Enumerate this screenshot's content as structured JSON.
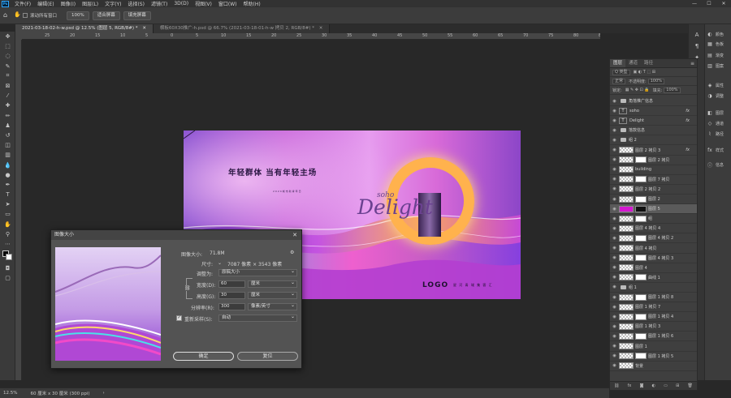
{
  "menubar": {
    "logo": "Ps",
    "items": [
      "文件(F)",
      "编辑(E)",
      "图像(I)",
      "图层(L)",
      "文字(Y)",
      "选择(S)",
      "滤镜(T)",
      "3D(D)",
      "视图(V)",
      "窗口(W)",
      "帮助(H)"
    ],
    "minimize": "—",
    "maximize": "☐",
    "close": "✕"
  },
  "options": {
    "scroll_all_label": "滚动所有窗口",
    "zoom_value": "100%",
    "fit_screen_label": "适合屏幕",
    "fill_screen_label": "填充屏幕"
  },
  "tabs": [
    {
      "label": "2021-03-18-02-h-w.psd @ 12.5% (图层 5, RGB/8#) *",
      "close": "✕"
    },
    {
      "label": "横板60X30推广-h.psd @ 66.7% (2021-03-18-01-h-w 拷贝 2, RGB/8#) *",
      "close": "✕"
    }
  ],
  "ruler_numbers": [
    "25",
    "20",
    "15",
    "10",
    "5",
    "0",
    "5",
    "10",
    "15",
    "20",
    "25",
    "30",
    "35",
    "40",
    "45",
    "50",
    "55",
    "60",
    "65",
    "70",
    "75",
    "80",
    "85"
  ],
  "artwork": {
    "headline": "年轻群体  当有年轻主场",
    "tagline": "2024城市新青年日",
    "script_small": "soho",
    "script_large": "Delight",
    "logo": "LOGO",
    "small_line": "星 河 青 域 集 客 汇"
  },
  "dialog": {
    "title": "图像大小",
    "image_size_label": "图像大小:",
    "image_size_value": "71.8M",
    "dimensions_label": "尺寸:",
    "dimensions_value": "7087 像素 × 3543 像素",
    "fit_label": "调整为:",
    "fit_value": "原稿大小",
    "width_label": "宽度(D):",
    "width_value": "60",
    "width_unit": "厘米",
    "height_label": "高度(G):",
    "height_value": "30",
    "height_unit": "厘米",
    "resolution_label": "分辨率(R):",
    "resolution_value": "300",
    "resolution_unit": "像素/英寸",
    "resample_label": "重新采样(S):",
    "resample_checked": true,
    "resample_value": "自动",
    "ok_label": "确定",
    "reset_label": "复位"
  },
  "right_panels": [
    {
      "icon": "◐",
      "label": "颜色"
    },
    {
      "icon": "▦",
      "label": "色板"
    },
    {
      "icon": "▤",
      "label": "渐变"
    },
    {
      "icon": "▥",
      "label": "图案"
    },
    {
      "icon": "◈",
      "label": "属性"
    },
    {
      "icon": "◑",
      "label": "调整"
    },
    {
      "icon": "◧",
      "label": "图层"
    },
    {
      "icon": "◇",
      "label": "通道"
    },
    {
      "icon": "⌇",
      "label": "路径"
    },
    {
      "icon": "fx",
      "label": "样式"
    },
    {
      "icon": "ⓘ",
      "label": "信息"
    }
  ],
  "layers_panel": {
    "tabs": [
      "图层",
      "通道",
      "路径"
    ],
    "search_label": "Q 类型",
    "blend_mode": "正常",
    "opacity_label": "不透明度:",
    "opacity_value": "100%",
    "lock_label": "锁定:",
    "fill_label": "填充:",
    "fill_value": "100%",
    "layers": [
      {
        "name": "角落推广信息",
        "kind": "folder",
        "fx": false,
        "selected": false
      },
      {
        "name": "soho",
        "kind": "text",
        "fx": true,
        "selected": false
      },
      {
        "name": "Delight",
        "kind": "text",
        "fx": true,
        "selected": false
      },
      {
        "name": "落款信息",
        "kind": "folder",
        "fx": false,
        "selected": false
      },
      {
        "name": "组 2",
        "kind": "folder",
        "fx": false,
        "selected": false
      },
      {
        "name": "图层 2 拷贝 3",
        "kind": "layer",
        "fx": true,
        "selected": false
      },
      {
        "name": "图层 2 拷贝",
        "kind": "layer",
        "fx": false,
        "selected": false
      },
      {
        "name": "building",
        "kind": "layer",
        "fx": false,
        "selected": false
      },
      {
        "name": "图层 7 拷贝",
        "kind": "layer",
        "fx": false,
        "selected": false
      },
      {
        "name": "图层 2 拷贝 2",
        "kind": "layer",
        "fx": false,
        "selected": false
      },
      {
        "name": "图层 2",
        "kind": "layer",
        "fx": false,
        "selected": false
      },
      {
        "name": "图层 5",
        "kind": "layer",
        "fx": false,
        "selected": true
      },
      {
        "name": "组",
        "kind": "layer",
        "fx": false,
        "selected": false
      },
      {
        "name": "图层 4 拷贝 4",
        "kind": "layer",
        "fx": false,
        "selected": false
      },
      {
        "name": "图层 4 拷贝 2",
        "kind": "layer",
        "fx": false,
        "selected": false
      },
      {
        "name": "图层 4 拷贝",
        "kind": "layer",
        "fx": false,
        "selected": false
      },
      {
        "name": "图层 4 拷贝 3",
        "kind": "layer",
        "fx": false,
        "selected": false
      },
      {
        "name": "图层 4",
        "kind": "layer",
        "fx": false,
        "selected": false
      },
      {
        "name": "曲线 1",
        "kind": "layer",
        "fx": false,
        "selected": false
      },
      {
        "name": "组 1",
        "kind": "folder",
        "fx": false,
        "selected": false
      },
      {
        "name": "图层 1 拷贝 8",
        "kind": "layer",
        "fx": false,
        "selected": false
      },
      {
        "name": "图层 1 拷贝 7",
        "kind": "layer",
        "fx": false,
        "selected": false
      },
      {
        "name": "图层 1 拷贝 4",
        "kind": "layer",
        "fx": false,
        "selected": false
      },
      {
        "name": "图层 1 拷贝 3",
        "kind": "layer",
        "fx": false,
        "selected": false
      },
      {
        "name": "图层 1 拷贝 6",
        "kind": "layer",
        "fx": false,
        "selected": false
      },
      {
        "name": "图层 1",
        "kind": "layer",
        "fx": false,
        "selected": false
      },
      {
        "name": "图层 1 拷贝 5",
        "kind": "layer",
        "fx": false,
        "selected": false
      },
      {
        "name": "背景",
        "kind": "layer",
        "fx": false,
        "selected": false
      }
    ]
  },
  "status": {
    "zoom": "12.5%",
    "doc_info": "60 厘米 x 30 厘米 (300 ppi)",
    "arrow": "›"
  },
  "colors": {
    "accent": "#31a8ff",
    "panel": "#3f3f3f",
    "canvas_bg": "#282828"
  }
}
